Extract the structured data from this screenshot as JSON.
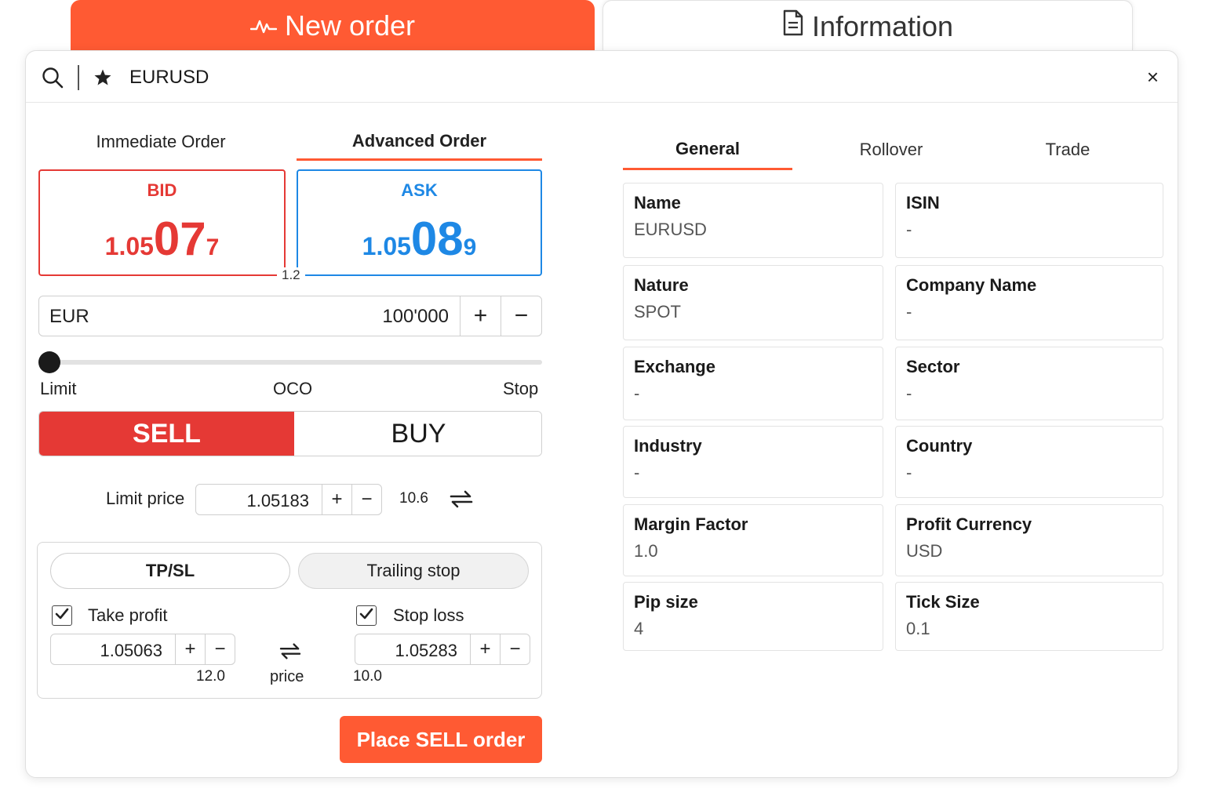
{
  "top_tabs": {
    "new_order": "New order",
    "information": "Information"
  },
  "search": {
    "symbol": "EURUSD",
    "close": "×"
  },
  "order_tabs": [
    "Immediate Order",
    "Advanced Order"
  ],
  "quotes": {
    "bid": {
      "label": "BID",
      "pre": "1.05",
      "big": "07",
      "post": "7"
    },
    "ask": {
      "label": "ASK",
      "pre": "1.05",
      "big": "08",
      "post": "9"
    },
    "spread": "1.2"
  },
  "amount": {
    "currency": "EUR",
    "value": "100'000",
    "plus": "+",
    "minus": "−"
  },
  "slider": {
    "labels": [
      "Limit",
      "OCO",
      "Stop"
    ],
    "selected": "Limit"
  },
  "side": {
    "sell": "SELL",
    "buy": "BUY",
    "selected": "SELL"
  },
  "limit": {
    "label": "Limit price",
    "value": "1.05183",
    "pips": "10.6"
  },
  "tpsl": {
    "tabs": [
      "TP/SL",
      "Trailing stop"
    ],
    "take_profit": {
      "label": "Take profit",
      "checked": true,
      "value": "1.05063",
      "pips": "12.0"
    },
    "stop_loss": {
      "label": "Stop loss",
      "checked": true,
      "value": "1.05283",
      "pips": "10.0"
    },
    "mode_label": "price"
  },
  "place_button": "Place SELL order",
  "info": {
    "tabs": [
      "General",
      "Rollover",
      "Trade"
    ],
    "fields": [
      {
        "title": "Name",
        "value": "EURUSD"
      },
      {
        "title": "ISIN",
        "value": "-"
      },
      {
        "title": "Nature",
        "value": "SPOT"
      },
      {
        "title": "Company Name",
        "value": "-"
      },
      {
        "title": "Exchange",
        "value": "-"
      },
      {
        "title": "Sector",
        "value": "-"
      },
      {
        "title": "Industry",
        "value": "-"
      },
      {
        "title": "Country",
        "value": "-"
      },
      {
        "title": "Margin Factor",
        "value": "1.0"
      },
      {
        "title": "Profit Currency",
        "value": "USD"
      },
      {
        "title": "Pip size",
        "value": "4"
      },
      {
        "title": "Tick Size",
        "value": "0.1"
      }
    ]
  },
  "colors": {
    "accent": "#ff5a33",
    "bid": "#e53935",
    "ask": "#1e88e5"
  },
  "icons": [
    "activity-icon",
    "document-icon",
    "search-icon",
    "star-icon",
    "close-icon",
    "swap-arrows-icon",
    "check-icon"
  ]
}
